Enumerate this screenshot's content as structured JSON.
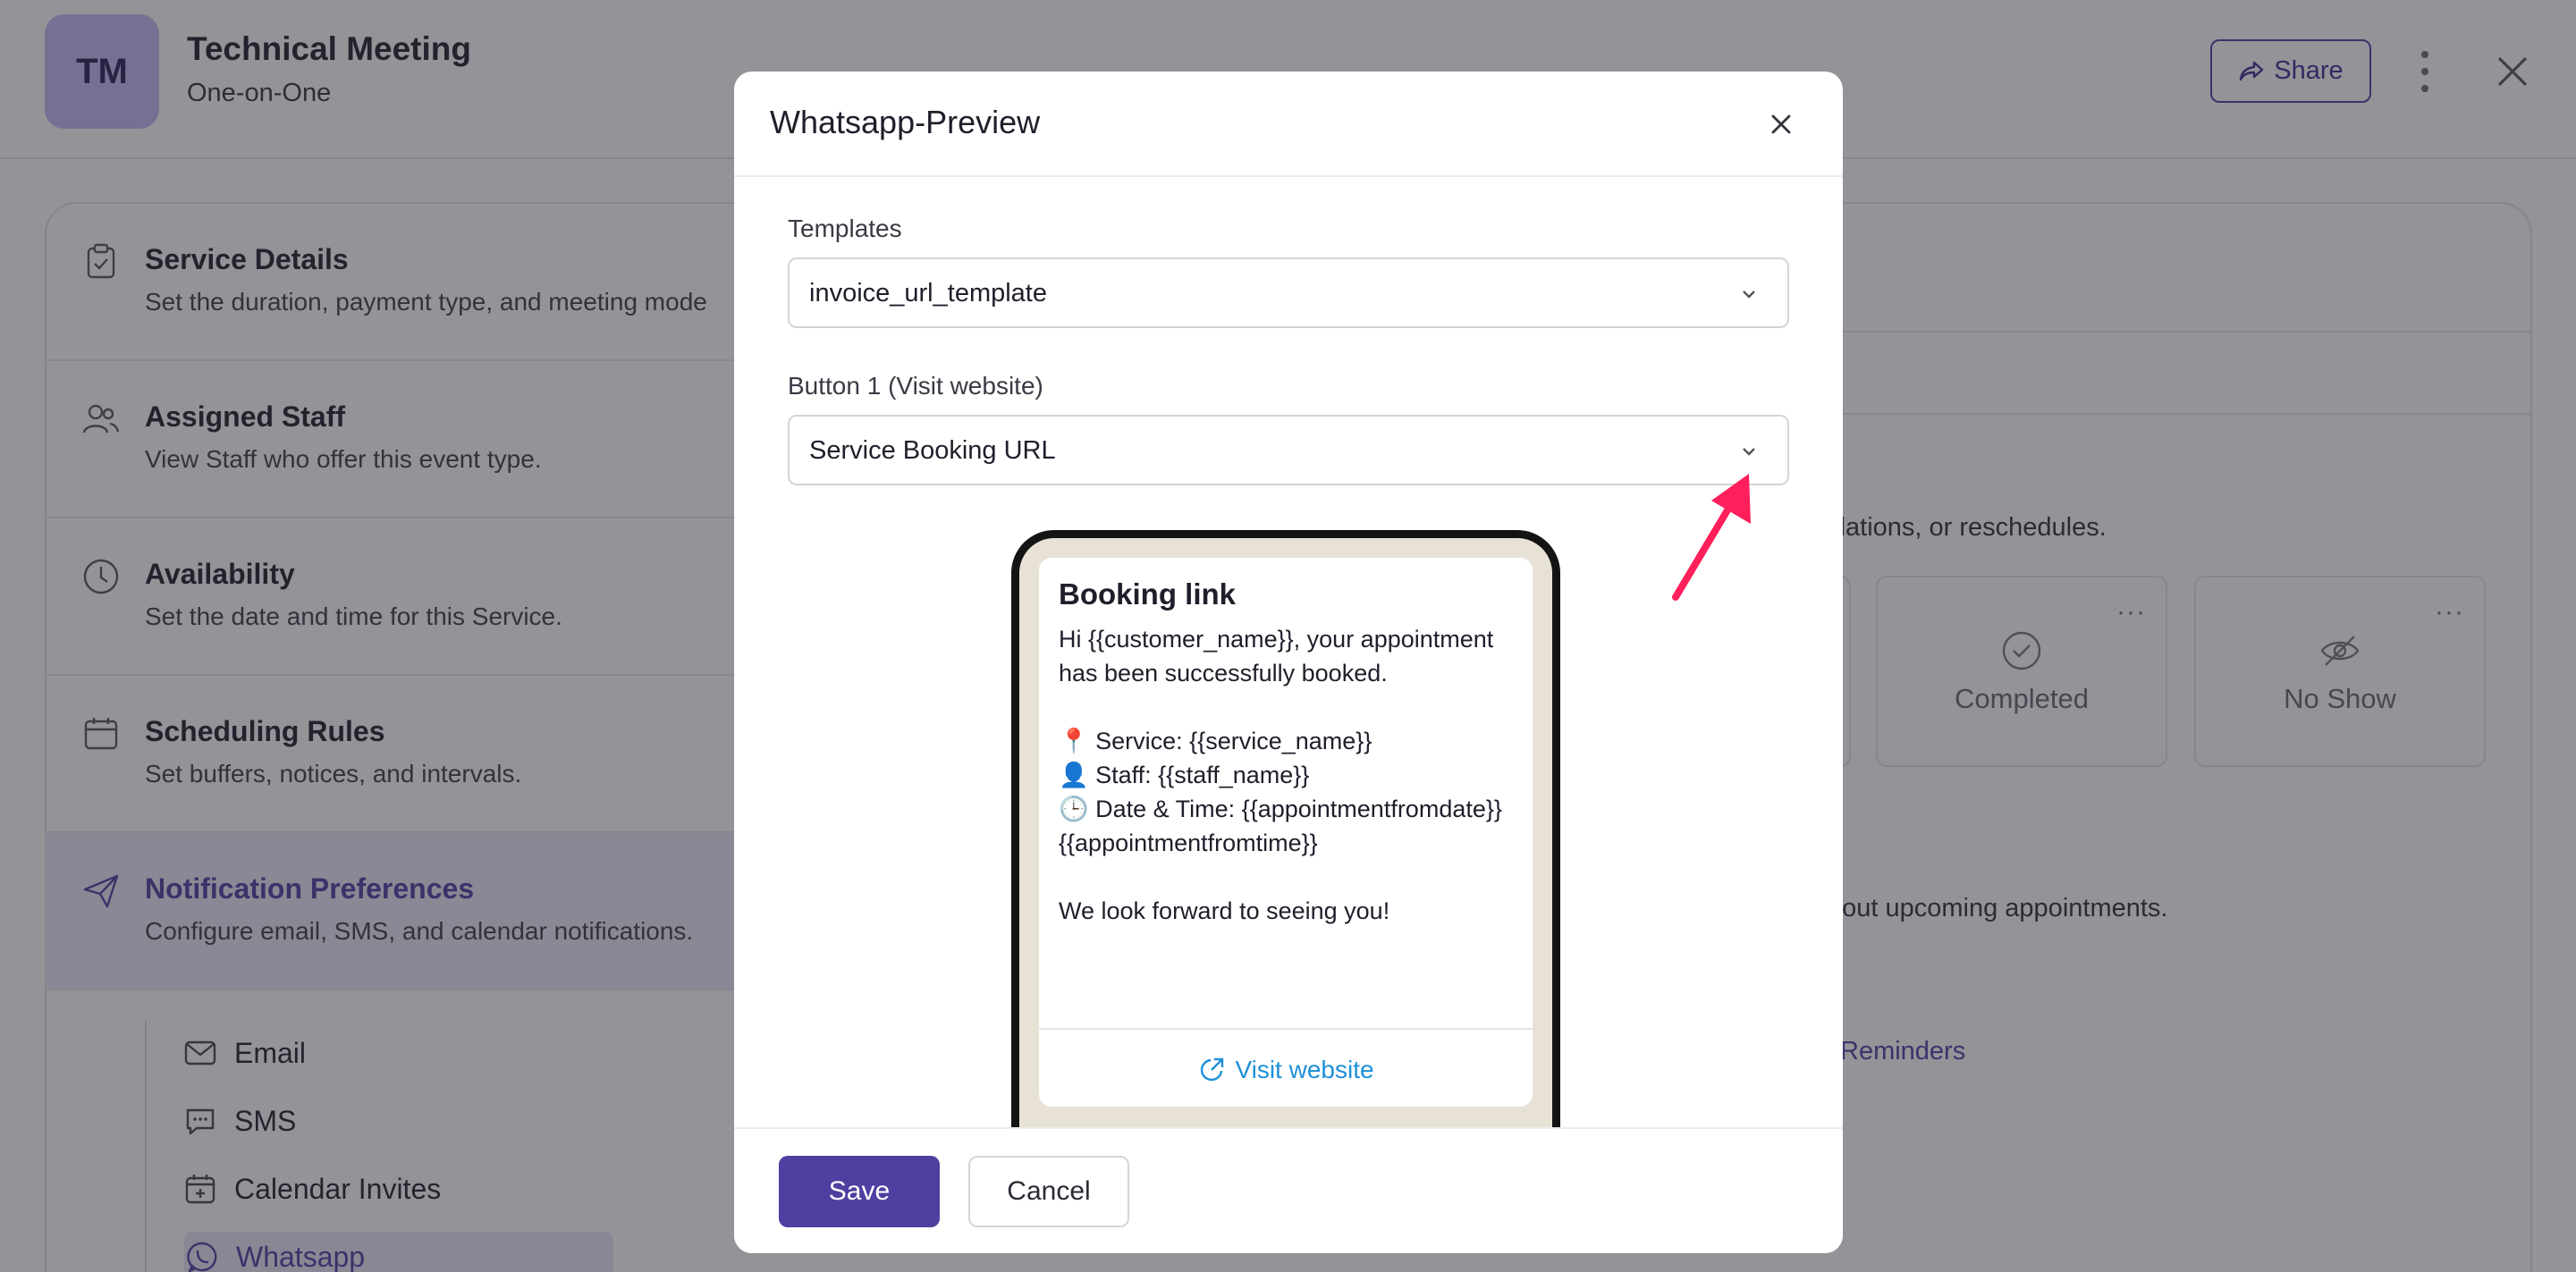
{
  "header": {
    "avatar_initials": "TM",
    "title": "Technical Meeting",
    "subtitle": "One-on-One",
    "share_label": "Share"
  },
  "sidebar": {
    "items": [
      {
        "title": "Service Details",
        "desc": "Set the duration, payment type, and meeting mode",
        "icon": "clipboard-check-icon"
      },
      {
        "title": "Assigned Staff",
        "desc": "View Staff who offer this event type.",
        "icon": "users-icon"
      },
      {
        "title": "Availability",
        "desc": "Set the date and time for this Service.",
        "icon": "clock-icon"
      },
      {
        "title": "Scheduling Rules",
        "desc": "Set buffers, notices, and intervals.",
        "icon": "calendar-icon"
      },
      {
        "title": "Notification Preferences",
        "desc": "Configure email, SMS, and calendar notifications.",
        "icon": "paper-plane-icon"
      }
    ],
    "sub_items": [
      "Email",
      "SMS",
      "Calendar Invites",
      "Whatsapp"
    ]
  },
  "background": {
    "text_cancellations": "ellations, or reschedules.",
    "status_cards": [
      "Completed",
      "No Show"
    ],
    "text_upcoming": "bout upcoming appointments.",
    "reminders_link": "Reminders"
  },
  "modal": {
    "title": "Whatsapp-Preview",
    "templates_label": "Templates",
    "templates_value": "invoice_url_template",
    "button1_label": "Button 1 (Visit website)",
    "button1_value": "Service Booking URL",
    "preview": {
      "title": "Booking link",
      "body": "Hi {{customer_name}}, your appointment has been successfully booked.\n\n📍 Service: {{service_name}}\n👤 Staff: {{staff_name}}\n🕒 Date & Time: {{appointmentfromdate}} {{appointmentfromtime}}\n\nWe look forward to seeing you!",
      "link_label": "Visit website"
    },
    "save_label": "Save",
    "cancel_label": "Cancel"
  },
  "colors": {
    "accent": "#4f3fa0",
    "link": "#1e90d8",
    "annotation_arrow": "#ff1f5a"
  }
}
